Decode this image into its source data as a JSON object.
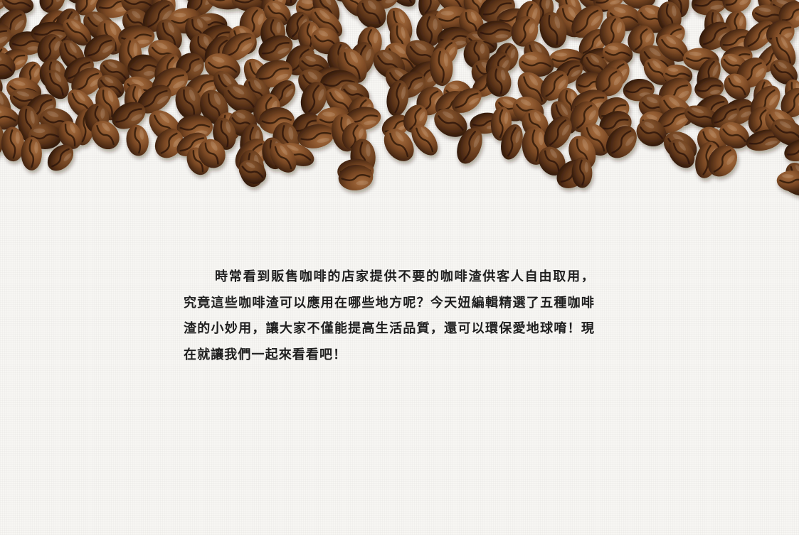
{
  "hero": {
    "image": "coffee-beans-border"
  },
  "article": {
    "intro": "時常看到販售咖啡的店家提供不要的咖啡渣供客人自由取用，究竟這些咖啡渣可以應用在哪些地方呢？今天妞編輯精選了五種咖啡渣的小妙用，讓大家不僅能提高生活品質，還可以環保愛地球唷！現在就讓我們一起來看看吧！"
  },
  "colors": {
    "background": "#f7f6f3",
    "text": "#1f1f1f",
    "bean_dark": "#4a2a14",
    "bean_mid": "#7b4a27",
    "bean_light": "#9c6639"
  }
}
